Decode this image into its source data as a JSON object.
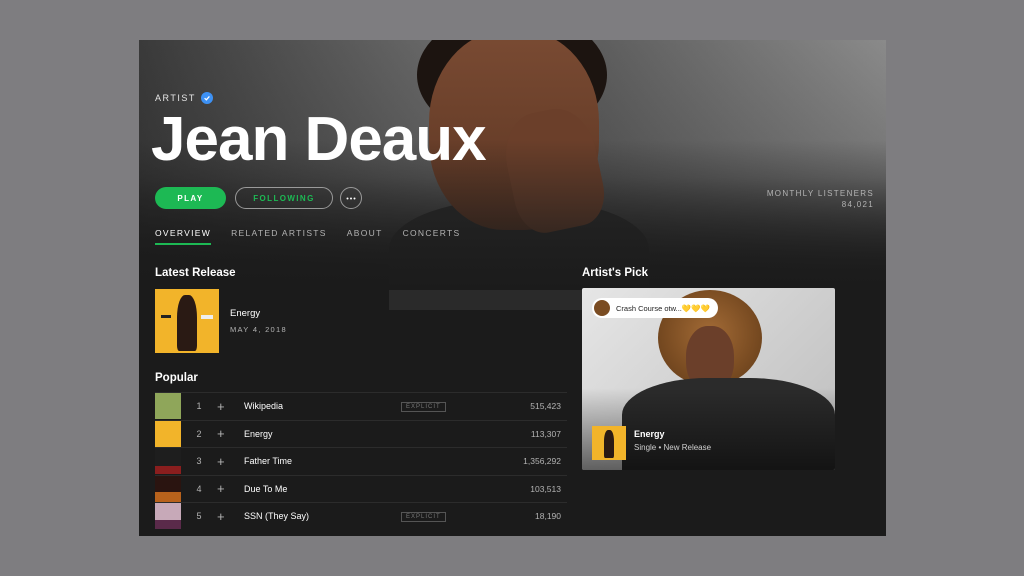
{
  "header": {
    "type_label": "ARTIST",
    "artist_name": "Jean Deaux",
    "play_label": "PLAY",
    "follow_label": "FOLLOWING",
    "more_label": "•••",
    "monthly_listeners_label": "MONTHLY LISTENERS",
    "monthly_listeners_value": "84,021"
  },
  "tabs": [
    {
      "label": "OVERVIEW",
      "active": true
    },
    {
      "label": "RELATED ARTISTS",
      "active": false
    },
    {
      "label": "ABOUT",
      "active": false
    },
    {
      "label": "CONCERTS",
      "active": false
    }
  ],
  "latest_release": {
    "section_title": "Latest Release",
    "title": "Energy",
    "date": "MAY 4, 2018"
  },
  "popular": {
    "section_title": "Popular",
    "tracks": [
      {
        "num": "1",
        "title": "Wikipedia",
        "explicit": "EXPLICIT",
        "plays": "515,423",
        "thumb_color": "#8fa65a"
      },
      {
        "num": "2",
        "title": "Energy",
        "explicit": "",
        "plays": "113,307",
        "thumb_color": "#f2b42a"
      },
      {
        "num": "3",
        "title": "Father Time",
        "explicit": "",
        "plays": "1,356,292",
        "thumb_color": "#1e1e1e"
      },
      {
        "num": "4",
        "title": "Due To Me",
        "explicit": "",
        "plays": "103,513",
        "thumb_color": "#2a1410"
      },
      {
        "num": "5",
        "title": "SSN (They Say)",
        "explicit": "EXPLICIT",
        "plays": "18,190",
        "thumb_color": "#c7a9b8"
      }
    ]
  },
  "artists_pick": {
    "section_title": "Artist's Pick",
    "pill_text": "Crash Course otw...💛💛💛",
    "title": "Energy",
    "subtitle": "Single • New Release"
  },
  "colors": {
    "accent": "#1db954",
    "verified": "#3d91f4",
    "background": "#1b1b1b"
  },
  "icons": [
    "verified-badge-icon",
    "plus-icon",
    "more-icon"
  ]
}
